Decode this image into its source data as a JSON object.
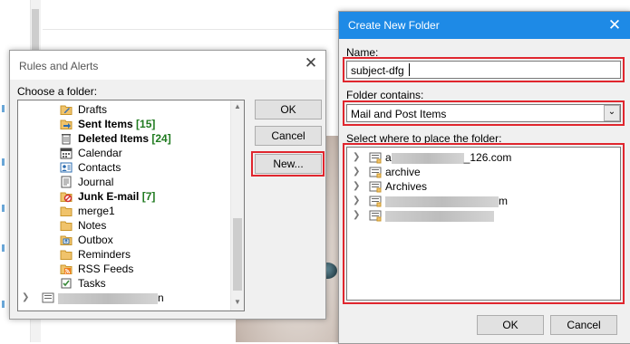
{
  "rules_dialog": {
    "title": "Rules and Alerts",
    "choose_label": "Choose a folder:",
    "folders": [
      {
        "name": "Drafts",
        "count": "",
        "bold": false,
        "icon": "drafts-folder-icon"
      },
      {
        "name": "Sent Items",
        "count": "[15]",
        "bold": true,
        "icon": "sent-folder-icon"
      },
      {
        "name": "Deleted Items",
        "count": "[24]",
        "bold": true,
        "icon": "trash-folder-icon"
      },
      {
        "name": "Calendar",
        "count": "",
        "bold": false,
        "icon": "calendar-icon"
      },
      {
        "name": "Contacts",
        "count": "",
        "bold": false,
        "icon": "contacts-icon"
      },
      {
        "name": "Journal",
        "count": "",
        "bold": false,
        "icon": "journal-icon"
      },
      {
        "name": "Junk E-mail",
        "count": "[7]",
        "bold": true,
        "icon": "junk-folder-icon"
      },
      {
        "name": "merge1",
        "count": "",
        "bold": false,
        "icon": "folder-icon"
      },
      {
        "name": "Notes",
        "count": "",
        "bold": false,
        "icon": "folder-icon"
      },
      {
        "name": "Outbox",
        "count": "",
        "bold": false,
        "icon": "outbox-folder-icon"
      },
      {
        "name": "Reminders",
        "count": "",
        "bold": false,
        "icon": "folder-icon"
      },
      {
        "name": "RSS Feeds",
        "count": "",
        "bold": false,
        "icon": "rss-folder-icon"
      },
      {
        "name": "Tasks",
        "count": "",
        "bold": false,
        "icon": "tasks-icon"
      }
    ],
    "account_suffix": "n",
    "ok_label": "OK",
    "cancel_label": "Cancel",
    "new_label": "New..."
  },
  "create_dialog": {
    "title": "Create New Folder",
    "name_label": "Name:",
    "name_value": "subject-dfg",
    "contains_label": "Folder contains:",
    "contains_value": "Mail and Post Items",
    "place_label": "Select where to place the folder:",
    "places": [
      {
        "prefix": "a",
        "suffix": "_126.com"
      },
      {
        "prefix": "archive",
        "suffix": ""
      },
      {
        "prefix": "Archives",
        "suffix": ""
      },
      {
        "prefix": "",
        "suffix": "m"
      },
      {
        "prefix": "",
        "suffix": ""
      }
    ],
    "ok_label": "OK",
    "cancel_label": "Cancel"
  },
  "colors": {
    "highlight_box": "#e0262e",
    "title_bar": "#1e8ae6",
    "count_green": "#1f7a1f"
  }
}
